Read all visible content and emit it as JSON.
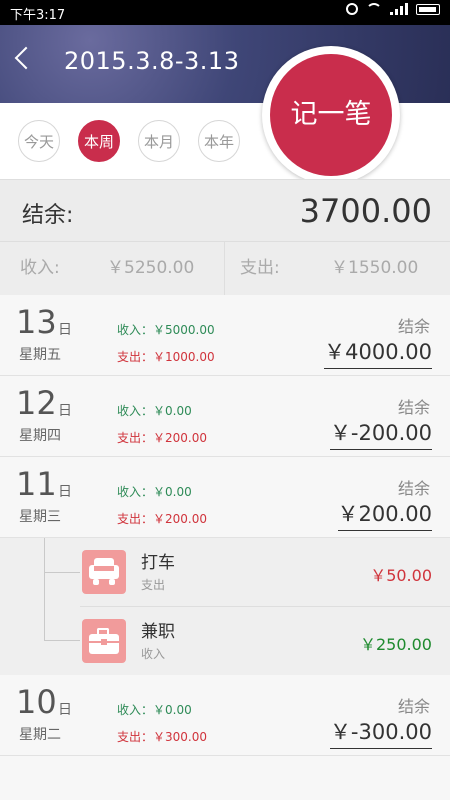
{
  "status_bar": {
    "time": "下午3:17"
  },
  "header": {
    "title": "2015.3.8-3.13"
  },
  "record_button": {
    "label": "记一笔"
  },
  "periods": [
    {
      "label": "今天",
      "active": false
    },
    {
      "label": "本周",
      "active": true
    },
    {
      "label": "本月",
      "active": false
    },
    {
      "label": "本年",
      "active": false
    }
  ],
  "summary": {
    "balance_label": "结余:",
    "balance_value": "3700.00",
    "income_label": "收入:",
    "income_value": "￥5250.00",
    "expense_label": "支出:",
    "expense_value": "￥1550.00"
  },
  "days": [
    {
      "day": "13",
      "ri": "日",
      "weekday": "星期五",
      "income": "收入：￥5000.00",
      "expense": "支出：￥1000.00",
      "balance_label": "结余",
      "balance": "￥4000.00"
    },
    {
      "day": "12",
      "ri": "日",
      "weekday": "星期四",
      "income": "收入：￥0.00",
      "expense": "支出：￥200.00",
      "balance_label": "结余",
      "balance": "￥-200.00"
    },
    {
      "day": "11",
      "ri": "日",
      "weekday": "星期三",
      "income": "收入：￥0.00",
      "expense": "支出：￥200.00",
      "balance_label": "结余",
      "balance": "￥200.00"
    },
    {
      "day": "10",
      "ri": "日",
      "weekday": "星期二",
      "income": "收入：￥0.00",
      "expense": "支出：￥300.00",
      "balance_label": "结余",
      "balance": "￥-300.00"
    }
  ],
  "details": [
    {
      "name": "打车",
      "type": "支出",
      "amount": "￥50.00",
      "icon": "taxi-icon",
      "color": "#d0343c"
    },
    {
      "name": "兼职",
      "type": "收入",
      "amount": "￥250.00",
      "icon": "briefcase-icon",
      "color": "#1e8a2e"
    }
  ],
  "colors": {
    "accent": "#c92d4c",
    "income": "#2e8b57",
    "expense": "#d0343c"
  }
}
